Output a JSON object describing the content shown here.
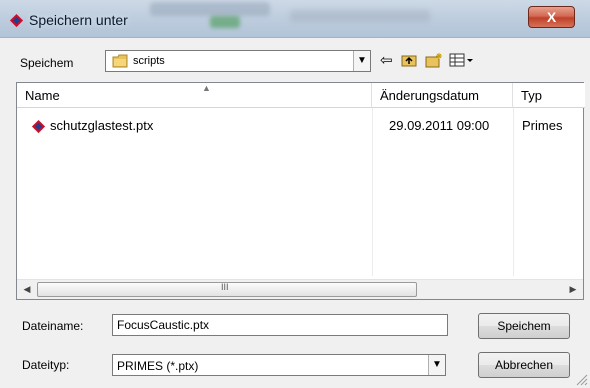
{
  "window": {
    "title": "Speichern unter",
    "close_label": "X"
  },
  "location": {
    "label": "Speichem",
    "folder": "scripts"
  },
  "toolbar": {
    "back_icon": "back-arrow-icon",
    "up_icon": "up-folder-icon",
    "new_folder_icon": "new-folder-icon",
    "view_icon": "view-menu-icon"
  },
  "file_list": {
    "columns": [
      "Name",
      "Änderungsdatum",
      "Typ"
    ],
    "rows": [
      {
        "name": "schutzglastest.ptx",
        "date": "29.09.2011 09:00",
        "type": "Primes"
      }
    ],
    "scroll_grip": "III"
  },
  "filename": {
    "label": "Dateiname:",
    "value": "FocusCaustic.ptx"
  },
  "filetype": {
    "label": "Dateityp:",
    "value": "PRIMES (*.ptx)"
  },
  "buttons": {
    "save": "Speichem",
    "cancel": "Abbrechen"
  },
  "colors": {
    "primes_icon_red": "#c8102e",
    "primes_icon_blue": "#1f3f8f",
    "close_button": "#c9452f"
  }
}
